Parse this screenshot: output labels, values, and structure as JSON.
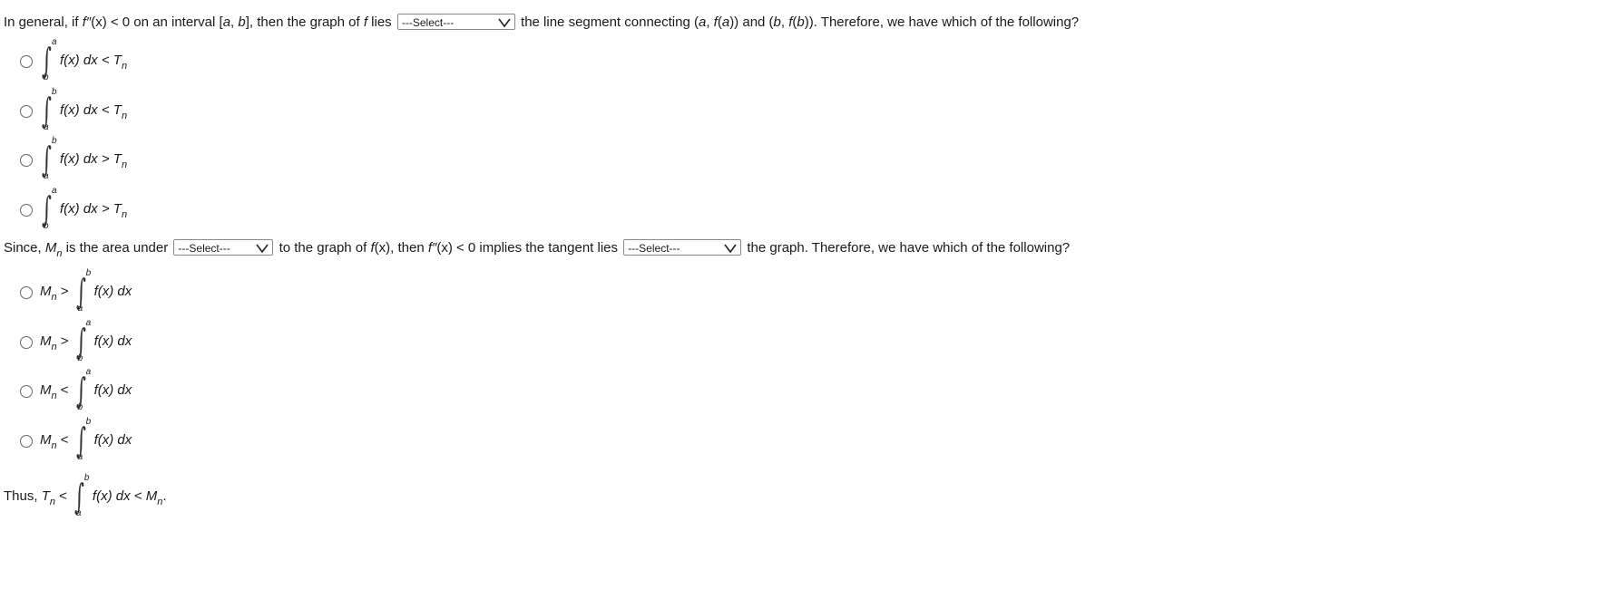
{
  "q1": {
    "p1": "In general, if ",
    "fpp": "f″",
    "p2": "(x) < 0 on an interval [",
    "a": "a",
    "comma": ", ",
    "b": "b",
    "p3": "], then the graph of ",
    "f": "f",
    "p4": " lies",
    "select": "---Select---",
    "p5": "the line segment connecting (",
    "p6": ", ",
    "fa": "f",
    "p7": "(",
    "p8": ")) and (",
    "p9": ")). Therefore, we have which of the following?"
  },
  "q1_options": [
    {
      "upper": "a",
      "lower": "b",
      "body": "f(x) dx < T",
      "sub": "n"
    },
    {
      "upper": "b",
      "lower": "a",
      "body": "f(x) dx < T",
      "sub": "n"
    },
    {
      "upper": "b",
      "lower": "a",
      "body": "f(x) dx > T",
      "sub": "n"
    },
    {
      "upper": "a",
      "lower": "b",
      "body": "f(x) dx > T",
      "sub": "n"
    }
  ],
  "q2": {
    "p1": "Since, ",
    "M": "M",
    "sub": "n",
    "p2": " is the area under",
    "select1": "---Select---",
    "p3": "to the graph of ",
    "f": "f",
    "p4": "(x), then ",
    "fpp": "f″",
    "p5": "(x) < 0 implies the tangent lies",
    "select2": "---Select---",
    "p6": "the graph. Therefore, we have which of the following?"
  },
  "q2_options": [
    {
      "left": "M",
      "sub": "n",
      "op": ">",
      "upper": "b",
      "lower": "a",
      "body": "f(x) dx"
    },
    {
      "left": "M",
      "sub": "n",
      "op": ">",
      "upper": "a",
      "lower": "b",
      "body": "f(x) dx"
    },
    {
      "left": "M",
      "sub": "n",
      "op": "<",
      "upper": "a",
      "lower": "b",
      "body": "f(x) dx"
    },
    {
      "left": "M",
      "sub": "n",
      "op": "<",
      "upper": "b",
      "lower": "a",
      "body": "f(x) dx"
    }
  ],
  "conclusion": {
    "p1": "Thus, ",
    "T": "T",
    "sub": "n",
    "op": " <",
    "upper": "b",
    "lower": "a",
    "body": "f(x) dx < ",
    "M": "M",
    "sub2": "n",
    "end": "."
  }
}
